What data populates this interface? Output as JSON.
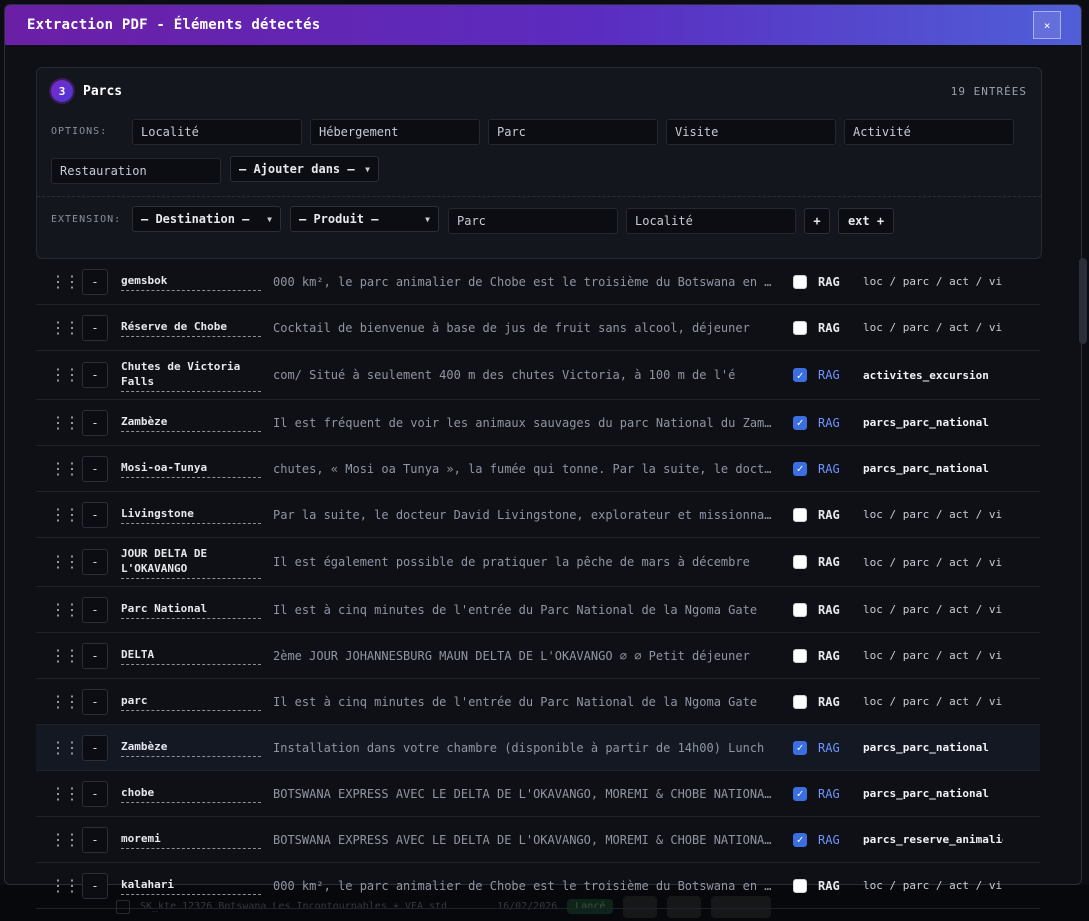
{
  "modal": {
    "title": "Extraction PDF - Éléments détectés",
    "close_label": "×"
  },
  "section": {
    "number": "3",
    "title": "Parcs",
    "count": "19 ENTRÉES",
    "options_label": "OPTIONS:",
    "options": [
      "Localité",
      "Hébergement",
      "Parc",
      "Visite",
      "Activité",
      "Restauration"
    ],
    "add_select": "— Ajouter dans —",
    "extension_label": "EXTENSION:",
    "destination_select": "— Destination —",
    "product_select": "— Produit —",
    "ext_parc": "Parc",
    "ext_localite": "Localité",
    "plus_label": "+",
    "ext_button": "ext +"
  },
  "rows": [
    {
      "term": "gemsbok",
      "snippet": "000 km², le parc animalier de Chobe est le troisième du Botswana en superficie",
      "rag_checked": false,
      "rag": "RAG",
      "category": "loc / parc / act / vi"
    },
    {
      "term": "Réserve de Chobe",
      "snippet": "Cocktail de bienvenue à base de jus de fruit sans alcool, déjeuner",
      "rag_checked": false,
      "rag": "RAG",
      "category": "loc / parc / act / vi"
    },
    {
      "term": "Chutes de Victoria Falls",
      "snippet": "com/ Situé à seulement 400 m des chutes Victoria, à 100 m de l'é",
      "rag_checked": true,
      "rag": "RAG",
      "category": "activites_excursion"
    },
    {
      "term": "Zambèze",
      "snippet": "Il est fréquent de voir les animaux sauvages du parc National du Zambèze",
      "rag_checked": true,
      "rag": "RAG",
      "category": "parcs_parc_national"
    },
    {
      "term": "Mosi-oa-Tunya",
      "snippet": "chutes, « Mosi oa Tunya », la fumée qui tonne. Par la suite, le docteur",
      "rag_checked": true,
      "rag": "RAG",
      "category": "parcs_parc_national"
    },
    {
      "term": "Livingstone",
      "snippet": "Par la suite, le docteur David Livingstone, explorateur et missionnaire",
      "rag_checked": false,
      "rag": "RAG",
      "category": "loc / parc / act / vi"
    },
    {
      "term": "JOUR DELTA DE L'OKAVANGO",
      "snippet": "Il est également possible de pratiquer la pêche de mars à décembre",
      "rag_checked": false,
      "rag": "RAG",
      "category": "loc / parc / act / vi"
    },
    {
      "term": "Parc National",
      "snippet": "Il est à cinq minutes de l'entrée du Parc National de la Ngoma Gate",
      "rag_checked": false,
      "rag": "RAG",
      "category": "loc / parc / act / vi"
    },
    {
      "term": "DELTA",
      "snippet": "2ème JOUR JOHANNESBURG MAUN DELTA DE L'OKAVANGO ∅ ∅ Petit déjeuner",
      "rag_checked": false,
      "rag": "RAG",
      "category": "loc / parc / act / vi"
    },
    {
      "term": "parc",
      "snippet": "Il est à cinq minutes de l'entrée du Parc National de la Ngoma Gate",
      "rag_checked": false,
      "rag": "RAG",
      "category": "loc / parc / act / vi"
    },
    {
      "term": "Zambèze",
      "snippet": "Installation dans votre chambre (disponible à partir de 14h00) Lunch",
      "rag_checked": true,
      "rag": "RAG",
      "category": "parcs_parc_national"
    },
    {
      "term": "chobe",
      "snippet": "BOTSWANA EXPRESS AVEC LE DELTA DE L'OKAVANGO, MOREMI & CHOBE NATIONAL PARK",
      "rag_checked": true,
      "rag": "RAG",
      "category": "parcs_parc_national"
    },
    {
      "term": "moremi",
      "snippet": "BOTSWANA EXPRESS AVEC LE DELTA DE L'OKAVANGO, MOREMI & CHOBE NATIONAL PARK",
      "rag_checked": true,
      "rag": "RAG",
      "category": "parcs_reserve_animalie"
    },
    {
      "term": "kalahari",
      "snippet": "000 km², le parc animalier de Chobe est le troisième du Botswana en superficie",
      "rag_checked": false,
      "rag": "RAG",
      "category": "loc / parc / act / vi"
    }
  ],
  "background": {
    "row_text": "SK_kte 12326 Botswana Les Incontournables + VFA std",
    "row_date": "16/02/2026",
    "row_status": "Lancé"
  },
  "colors": {
    "header_start": "#6b1fa5",
    "header_end": "#4f5fd8",
    "accent_blue": "#3b6fe0",
    "badge": "#7a27c9"
  }
}
